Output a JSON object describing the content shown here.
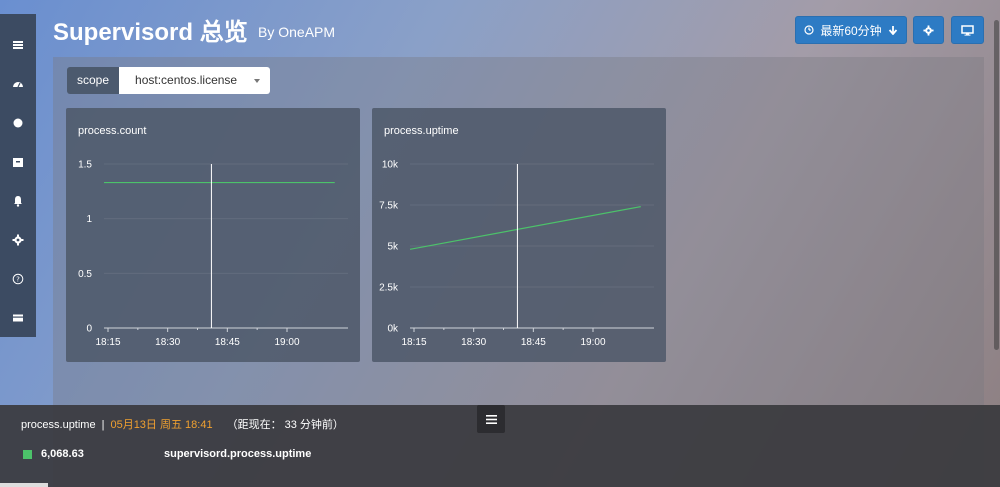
{
  "header": {
    "title": "Supervisord 总览",
    "by": "By  OneAPM",
    "time_range_label": "最新60分钟"
  },
  "sidebar": {
    "items": [
      {
        "icon": "list-icon"
      },
      {
        "icon": "dashboard-icon"
      },
      {
        "icon": "circle-icon"
      },
      {
        "icon": "archive-icon"
      },
      {
        "icon": "bell-icon"
      },
      {
        "icon": "gear-icon"
      },
      {
        "icon": "help-icon"
      },
      {
        "icon": "card-icon"
      }
    ]
  },
  "scope": {
    "label": "scope",
    "value": "host:centos.license"
  },
  "charts": {
    "count_title": "process.count",
    "uptime_title": "process.uptime"
  },
  "chart_data": [
    {
      "type": "line",
      "title": "process.count",
      "x_ticks": [
        "18:15",
        "18:30",
        "18:45",
        "19:00"
      ],
      "y_ticks": [
        "0",
        "0.5",
        "1",
        "1.5"
      ],
      "ylim": [
        0,
        1.5
      ],
      "series": [
        {
          "x": [
            "18:14",
            "19:12"
          ],
          "y": [
            1.33,
            1.33
          ]
        }
      ],
      "cursor_x": "18:41",
      "line_color": "#4cc26a"
    },
    {
      "type": "line",
      "title": "process.uptime",
      "x_ticks": [
        "18:15",
        "18:30",
        "18:45",
        "19:00"
      ],
      "y_ticks": [
        "0k",
        "2.5k",
        "5k",
        "7.5k",
        "10k"
      ],
      "ylim": [
        0,
        10000
      ],
      "series": [
        {
          "x": [
            "18:14",
            "19:12"
          ],
          "y": [
            4800,
            7400
          ]
        }
      ],
      "cursor_x": "18:41",
      "line_color": "#4cc26a"
    }
  ],
  "tooltip": {
    "metric": "process.uptime",
    "separator": "|",
    "timestamp": "05月13日 周五 18:41",
    "ago": "（距现在： 33 分钟前）",
    "value": "6,068.63",
    "series_name": "supervisord.process.uptime",
    "swatch_color": "#4cc26a"
  }
}
